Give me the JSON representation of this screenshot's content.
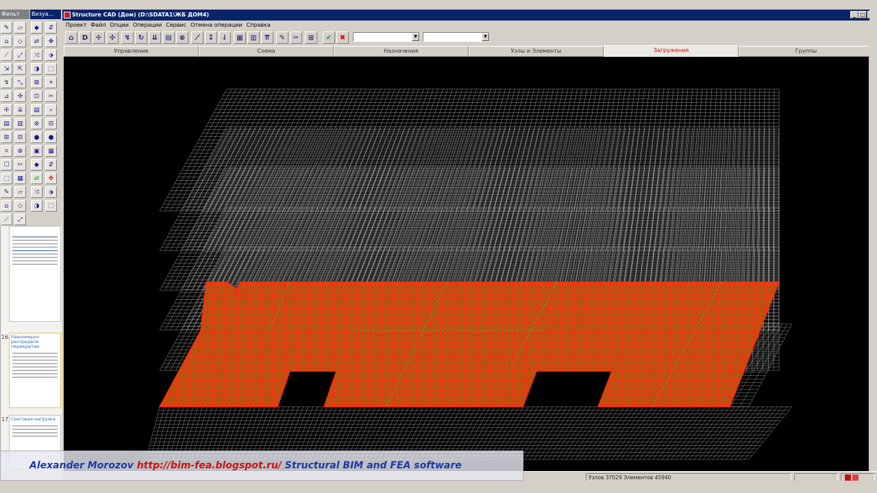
{
  "left_panel": {
    "tabs": [
      "Фильт",
      "Визуа..."
    ],
    "thumbnails": [
      {
        "num": "16",
        "title": "Равномерно распределе перекрытие"
      },
      {
        "num": "17",
        "title": "Снеговая нагрузка"
      }
    ]
  },
  "window": {
    "title": "Structure CAD (Дом) (D:\\SDATA1\\ЖБ ДОМ4)",
    "min": "_",
    "max": "□",
    "close": "×"
  },
  "menu": [
    "Проект",
    "Файл",
    "Опции",
    "Операции",
    "Сервис",
    "Отмена операции",
    "Справка"
  ],
  "toolbar": {
    "d_label": "D",
    "select1_value": "",
    "select2_value": ""
  },
  "tabs": [
    {
      "label": "Управление",
      "active": false
    },
    {
      "label": "Схема",
      "active": false
    },
    {
      "label": "Назначения",
      "active": false
    },
    {
      "label": "Узлы и Элементы",
      "active": false
    },
    {
      "label": "Загружения",
      "active": true
    },
    {
      "label": "Группы",
      "active": false
    }
  ],
  "status": {
    "nodes_elements": "Узлов 37029 Элементов 45940"
  },
  "banner": {
    "author": "Alexander Morozov",
    "url": "http://bim-fea.blogspot.ru/",
    "tagline": "Structural BIM and FEA software"
  },
  "colors": {
    "load_fill": "#b85a10",
    "load_mark": "#ff1a1a",
    "load_green": "#22cc22",
    "mesh": "#e0e0e0",
    "active_tab": "#e00000"
  }
}
